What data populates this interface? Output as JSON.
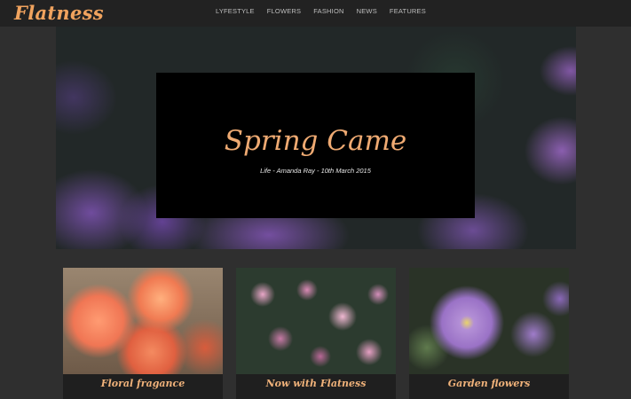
{
  "header": {
    "logo": "Flatness",
    "nav": [
      "LYFESTYLE",
      "FLOWERS",
      "FASHION",
      "NEWS",
      "FEATURES"
    ]
  },
  "hero": {
    "title": "Spring Came",
    "meta": "Life - Amanda Ray - 10th March 2015"
  },
  "cards": [
    {
      "title": "Floral fragance"
    },
    {
      "title": "Now with Flatness"
    },
    {
      "title": "Garden flowers"
    }
  ],
  "colors": {
    "accent": "#f0a35e",
    "header_bg": "#222222",
    "page_bg": "#2f2f2f",
    "card_bg": "#1f1f1f"
  }
}
